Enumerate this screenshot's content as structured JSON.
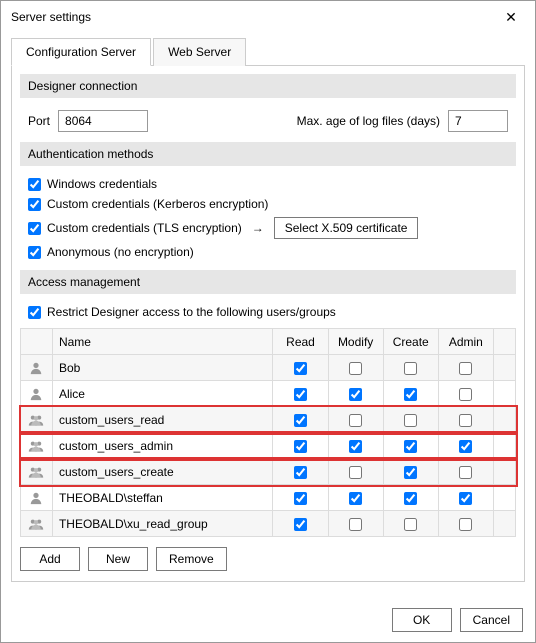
{
  "title": "Server settings",
  "tabs": {
    "config": "Configuration Server",
    "web": "Web Server"
  },
  "sections": {
    "designer": "Designer connection",
    "auth": "Authentication methods",
    "access": "Access management"
  },
  "fields": {
    "port_label": "Port",
    "port_value": "8064",
    "maxage_label": "Max. age of log files (days)",
    "maxage_value": "7"
  },
  "auth": {
    "windows": {
      "label": "Windows credentials",
      "checked": true
    },
    "kerberos": {
      "label": "Custom credentials (Kerberos encryption)",
      "checked": true
    },
    "tls": {
      "label": "Custom credentials (TLS encryption)",
      "checked": true
    },
    "tls_button": "Select X.509 certificate",
    "anonymous": {
      "label": "Anonymous (no encryption)",
      "checked": true
    }
  },
  "access": {
    "restrict": {
      "label": "Restrict Designer access to the following users/groups",
      "checked": true
    },
    "columns": {
      "name": "Name",
      "read": "Read",
      "modify": "Modify",
      "create": "Create",
      "admin": "Admin"
    },
    "rows": [
      {
        "icon": "person",
        "name": "Bob",
        "read": true,
        "modify": false,
        "create": false,
        "admin": false,
        "highlight": false
      },
      {
        "icon": "person",
        "name": "Alice",
        "read": true,
        "modify": true,
        "create": true,
        "admin": false,
        "highlight": false
      },
      {
        "icon": "group",
        "name": "custom_users_read",
        "read": true,
        "modify": false,
        "create": false,
        "admin": false,
        "highlight": true
      },
      {
        "icon": "group",
        "name": "custom_users_admin",
        "read": true,
        "modify": true,
        "create": true,
        "admin": true,
        "highlight": true
      },
      {
        "icon": "group",
        "name": "custom_users_create",
        "read": true,
        "modify": false,
        "create": true,
        "admin": false,
        "highlight": true
      },
      {
        "icon": "person",
        "name": "THEOBALD\\steffan",
        "read": true,
        "modify": true,
        "create": true,
        "admin": true,
        "highlight": false
      },
      {
        "icon": "group",
        "name": "THEOBALD\\xu_read_group",
        "read": true,
        "modify": false,
        "create": false,
        "admin": false,
        "highlight": false
      }
    ],
    "buttons": {
      "add": "Add",
      "new": "New",
      "remove": "Remove"
    }
  },
  "footer": {
    "ok": "OK",
    "cancel": "Cancel"
  }
}
